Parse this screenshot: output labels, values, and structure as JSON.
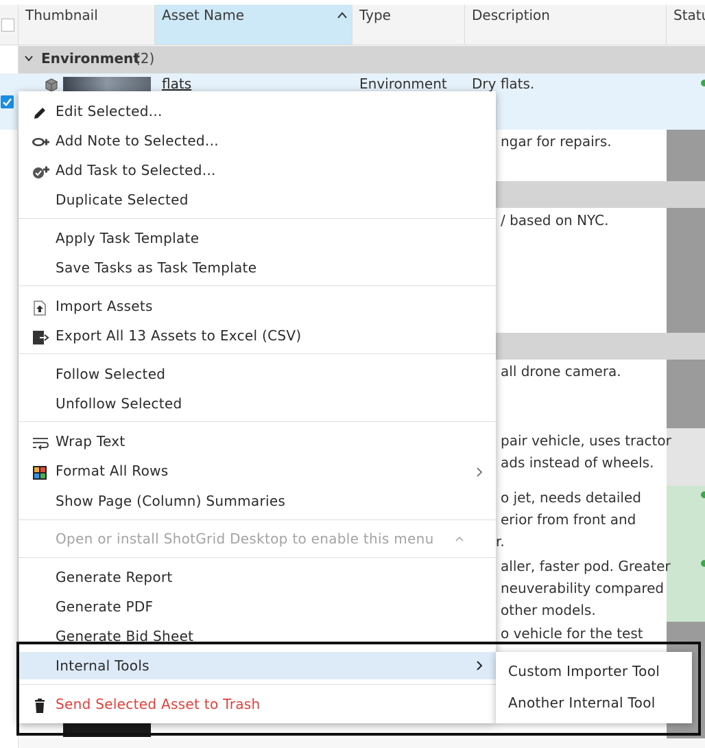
{
  "grid": {
    "headers": {
      "thumbnail": "Thumbnail",
      "asset_name": "Asset Name",
      "type": "Type",
      "description": "Description",
      "status": "Statu"
    },
    "group": {
      "name": "Environment",
      "count": "(2)"
    },
    "row1": {
      "name": "flats",
      "type": "Environment",
      "description": "Dry flats."
    },
    "desc_fragments": [
      "ngar for repairs.",
      "/ based on NYC.",
      "all drone camera.",
      "pair vehicle, uses tractor",
      "ads instead of wheels.",
      "o jet, needs detailed",
      "erior from front and",
      "r.",
      "aller, faster pod. Greater",
      "neuverability compared",
      "other models.",
      "o vehicle for the test"
    ]
  },
  "menu": {
    "edit_selected": "Edit Selected...",
    "add_note": "Add Note to Selected...",
    "add_task": "Add Task to Selected...",
    "duplicate": "Duplicate Selected",
    "apply_template": "Apply Task Template",
    "save_template": "Save Tasks as Task Template",
    "import_assets": "Import Assets",
    "export_assets": "Export All 13 Assets to Excel (CSV)",
    "follow": "Follow Selected",
    "unfollow": "Unfollow Selected",
    "wrap_text": "Wrap Text",
    "format_rows": "Format All Rows",
    "show_summaries": "Show Page (Column) Summaries",
    "desktop_notice": "Open or install ShotGrid Desktop to enable this menu",
    "generate_report": "Generate Report",
    "generate_pdf": "Generate PDF",
    "generate_bid": "Generate Bid Sheet",
    "internal_tools": "Internal Tools",
    "send_trash": "Send Selected Asset to Trash"
  },
  "submenu": {
    "custom_importer": "Custom Importer Tool",
    "another_tool": "Another Internal Tool"
  },
  "colors": {
    "accent": "#1a8ee0",
    "danger": "#e0403a",
    "sorted_header": "#cde8f6",
    "highlight": "#ddeaf8",
    "status_green": "#cde6cf",
    "status_gray": "#9b9b9b"
  }
}
